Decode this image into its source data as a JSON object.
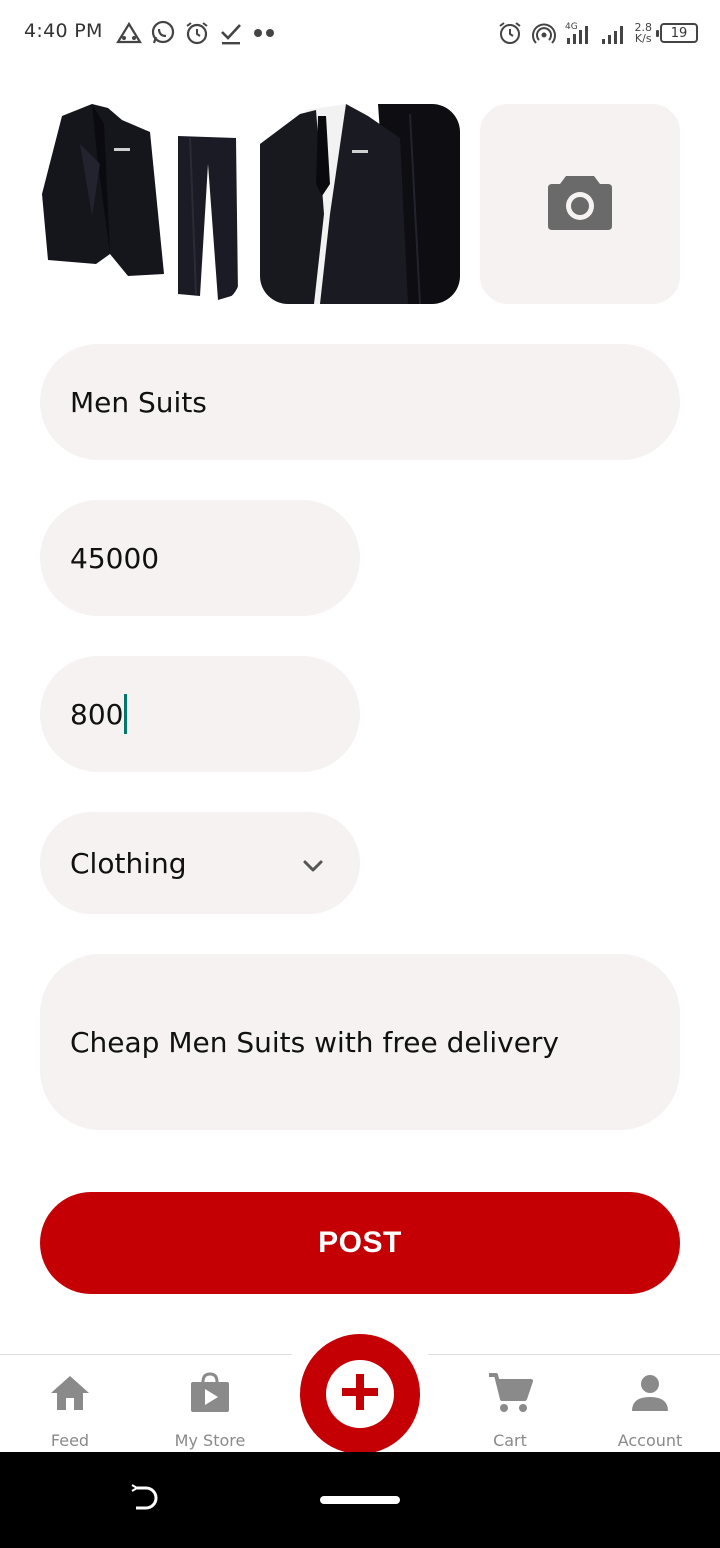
{
  "status_bar": {
    "time": "4:40 PM",
    "network_label": "4G",
    "speed_value": "2.8",
    "speed_unit": "K/s",
    "battery": "19"
  },
  "images": {
    "photo_1_alt": "suit-photo-1",
    "photo_2_alt": "suit-photo-2",
    "add_photo_icon": "camera-icon"
  },
  "form": {
    "name": "Men Suits",
    "price": "45000",
    "quantity": "800",
    "category": "Clothing",
    "description": "Cheap Men Suits with free delivery",
    "post_label": "POST"
  },
  "bottom_nav": {
    "items": [
      {
        "label": "Feed",
        "icon": "home-icon"
      },
      {
        "label": "My Store",
        "icon": "store-bag-icon"
      },
      {
        "label": "Cart",
        "icon": "cart-icon"
      },
      {
        "label": "Account",
        "icon": "person-icon"
      }
    ],
    "fab_icon": "plus-icon"
  },
  "colors": {
    "accent": "#c40005",
    "field_bg": "#f5f2f1",
    "cursor": "#00796b",
    "nav_icon": "#8a8a8a"
  }
}
